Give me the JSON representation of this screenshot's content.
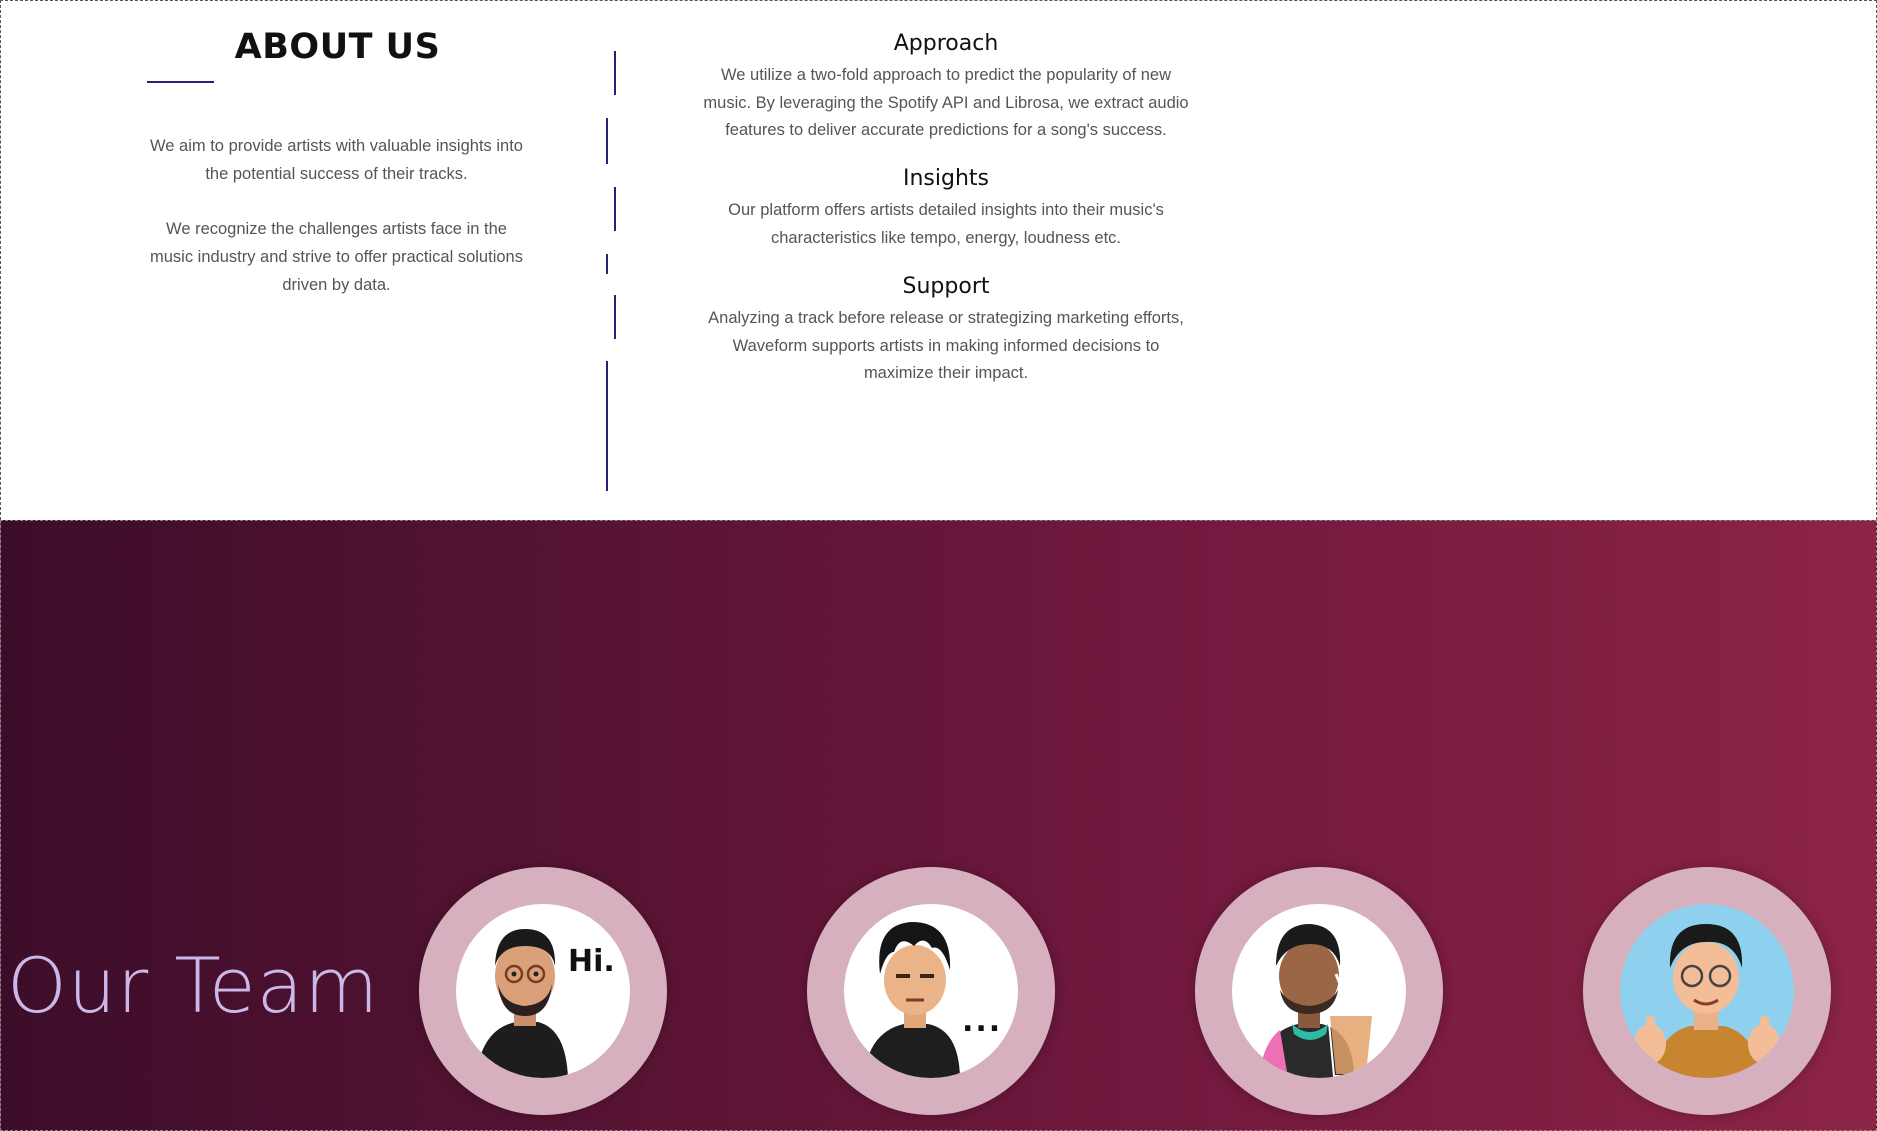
{
  "about": {
    "title": "ABOUT US",
    "intro": [
      "We aim to provide artists with valuable insights into the potential success of their tracks.",
      "We recognize the challenges artists face in the music industry and strive to offer practical solutions driven by data."
    ],
    "features": [
      {
        "heading": "Approach",
        "text": "We utilize a two-fold approach to predict the popularity of new music. By leveraging the Spotify API and Librosa, we extract audio features to deliver accurate predictions for a song's success."
      },
      {
        "heading": "Insights",
        "text": "Our platform offers artists detailed insights into their music's characteristics like tempo, energy, loudness etc."
      },
      {
        "heading": "Support",
        "text": "Analyzing a track before release or strategizing marketing efforts, Waveform supports artists in making informed decisions to maximize their impact."
      }
    ]
  },
  "team": {
    "title": "Our Team",
    "members": [
      {
        "avatar": "bitmoji-hi-avatar",
        "bubble": "Hi."
      },
      {
        "avatar": "bitmoji-ellipsis-avatar",
        "bubble": "..."
      },
      {
        "avatar": "bitmoji-drink-avatar",
        "bubble": ""
      },
      {
        "avatar": "memoji-thumbsup-avatar",
        "bubble": ""
      }
    ]
  },
  "colors": {
    "accent_navy": "#23237a",
    "team_gradient_start": "#3c0d29",
    "team_gradient_end": "#8c2446",
    "avatar_ring": "#d6b0be",
    "team_title": "#cbb7e8"
  }
}
